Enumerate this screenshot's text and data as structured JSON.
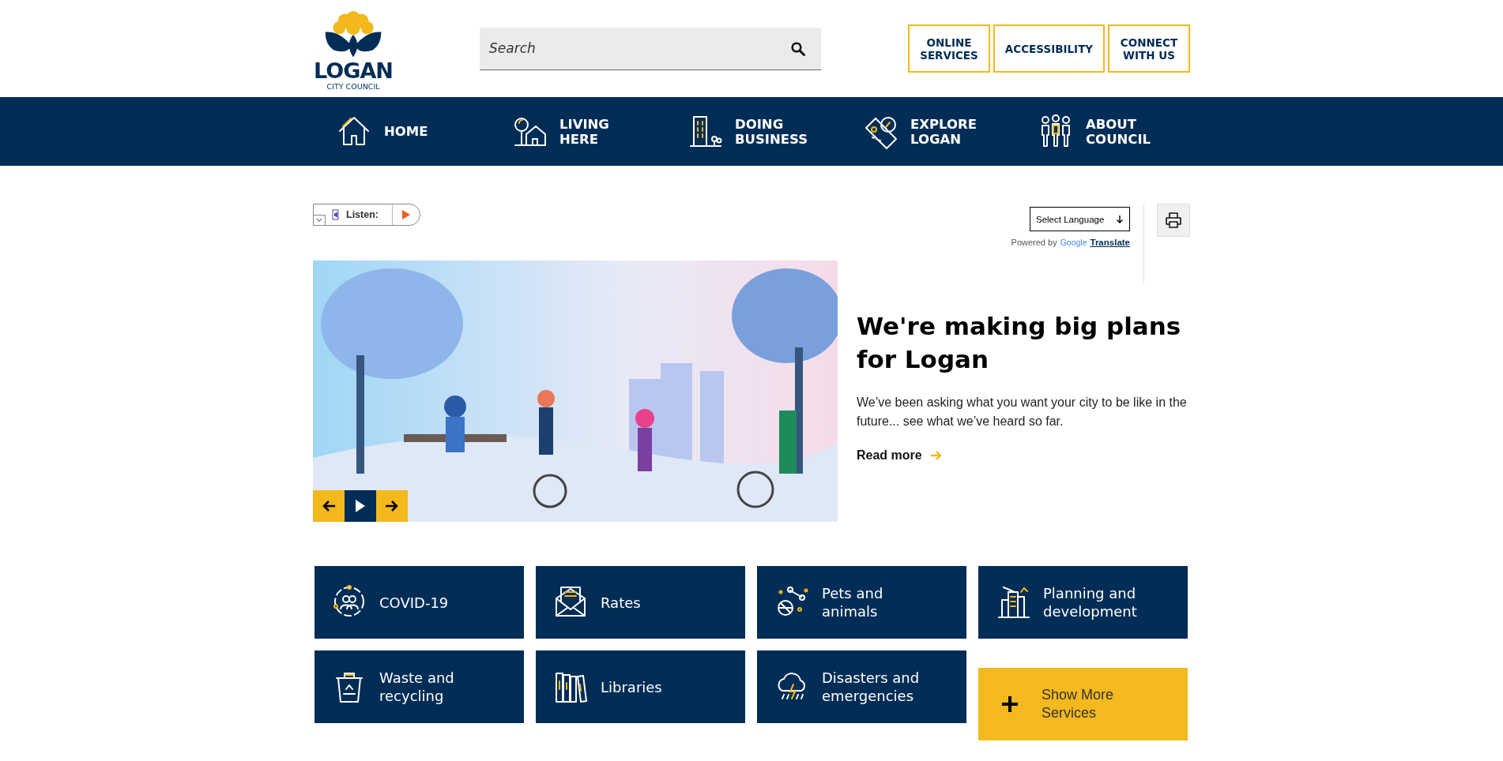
{
  "logo": {
    "name": "LOGAN",
    "subtitle": "CITY COUNCIL"
  },
  "search": {
    "placeholder": "Search"
  },
  "header_links": [
    "ONLINE SERVICES",
    "ACCESSIBILITY",
    "CONNECT WITH US"
  ],
  "nav": [
    {
      "label": "HOME"
    },
    {
      "label": "LIVING HERE"
    },
    {
      "label": "DOING BUSINESS"
    },
    {
      "label": "EXPLORE LOGAN"
    },
    {
      "label": "ABOUT COUNCIL"
    }
  ],
  "listen": {
    "label": "Listen:"
  },
  "translate": {
    "select": "Select Language",
    "powered_by": "Powered by",
    "brand": "Google",
    "link": "Translate"
  },
  "hero": {
    "title": "We're making big plans for Logan",
    "text": "We’ve been asking what you want your city to be like in the future... see what we’ve heard so far.",
    "link": "Read more"
  },
  "tiles": [
    {
      "label": "COVID-19",
      "kind": "service"
    },
    {
      "label": "Rates",
      "kind": "service"
    },
    {
      "label": "Pets and animals",
      "kind": "service"
    },
    {
      "label": "Planning and development",
      "kind": "service"
    },
    {
      "label": "Waste and recycling",
      "kind": "service"
    },
    {
      "label": "Libraries",
      "kind": "service"
    },
    {
      "label": "Disasters and emergencies",
      "kind": "service"
    },
    {
      "label": "Show More Services",
      "kind": "more"
    }
  ]
}
